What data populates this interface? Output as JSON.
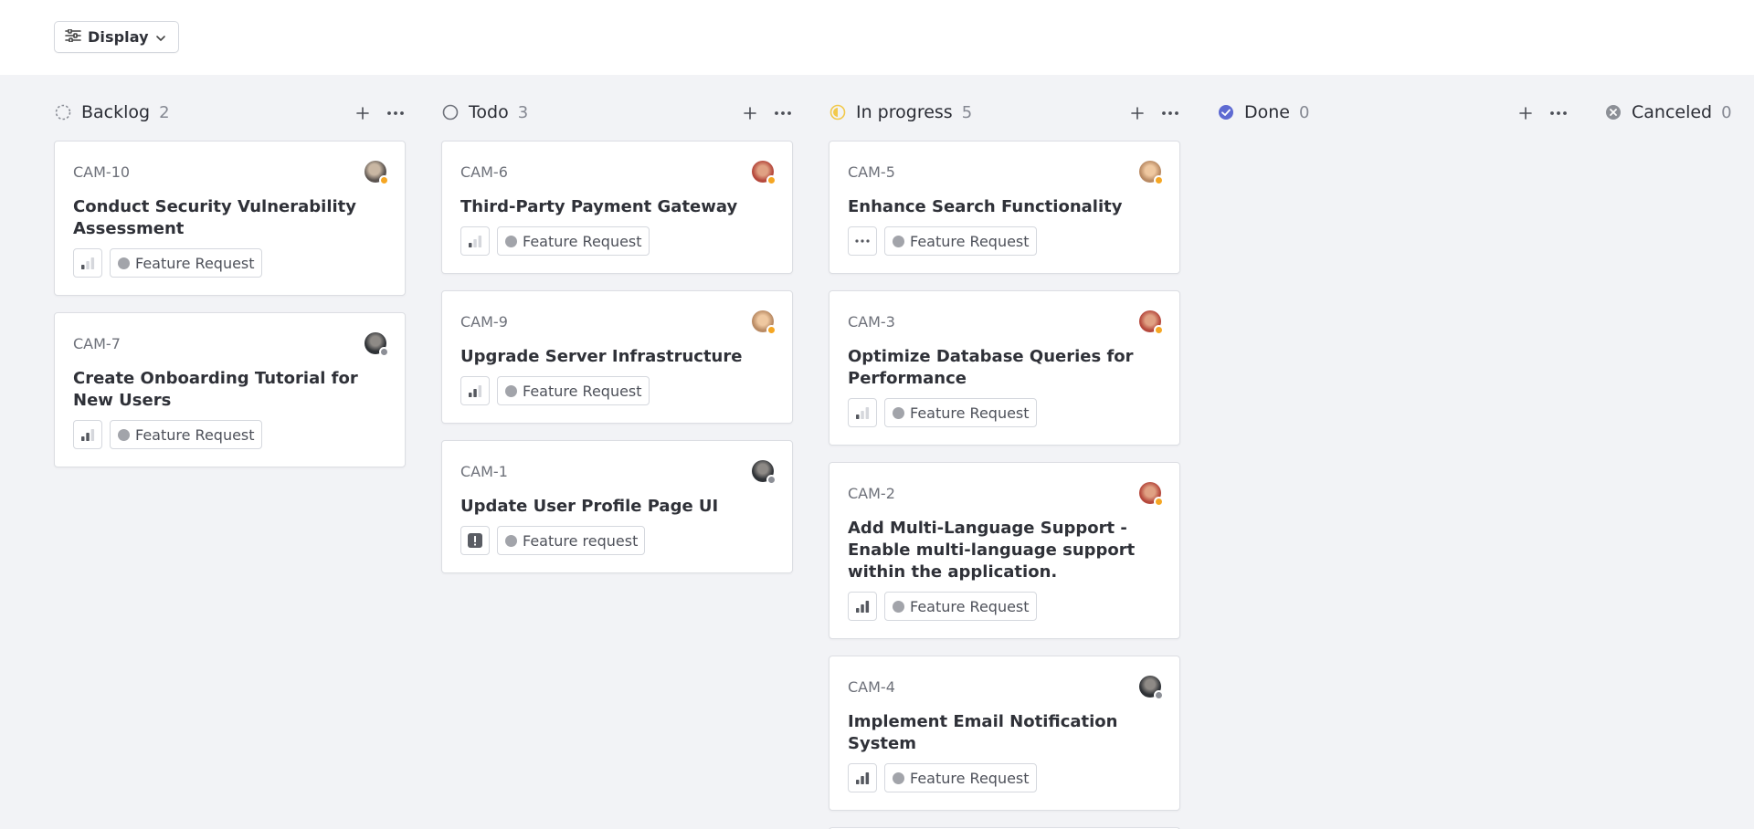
{
  "toolbar": {
    "display_label": "Display"
  },
  "columns": [
    {
      "title": "Backlog",
      "count": "2",
      "cards": [
        {
          "id": "CAM-10",
          "title": "Conduct Security Vulnerability Assessment",
          "label": "Feature Request",
          "priority": "low",
          "avatar_status": "away"
        },
        {
          "id": "CAM-7",
          "title": "Create Onboarding Tutorial for New Users",
          "label": "Feature Request",
          "priority": "medium",
          "avatar_status": "offline"
        }
      ]
    },
    {
      "title": "Todo",
      "count": "3",
      "cards": [
        {
          "id": "CAM-6",
          "title": "Third-Party Payment Gateway",
          "label": "Feature Request",
          "priority": "low",
          "avatar_status": "away"
        },
        {
          "id": "CAM-9",
          "title": "Upgrade Server Infrastructure",
          "label": "Feature Request",
          "priority": "medium",
          "avatar_status": "away"
        },
        {
          "id": "CAM-1",
          "title": "Update User Profile Page UI",
          "label": "Feature request",
          "priority": "urgent",
          "avatar_status": "offline"
        }
      ]
    },
    {
      "title": "In progress",
      "count": "5",
      "cards": [
        {
          "id": "CAM-5",
          "title": "Enhance Search Functionality",
          "label": "Feature Request",
          "priority": "none",
          "avatar_status": "away"
        },
        {
          "id": "CAM-3",
          "title": "Optimize Database Queries for Performance",
          "label": "Feature Request",
          "priority": "low",
          "avatar_status": "away"
        },
        {
          "id": "CAM-2",
          "title": "Add Multi-Language Support - Enable multi-language support within the application.",
          "label": "Feature Request",
          "priority": "high",
          "avatar_status": "away"
        },
        {
          "id": "CAM-4",
          "title": "Implement Email Notification System",
          "label": "Feature Request",
          "priority": "high",
          "avatar_status": "offline"
        }
      ]
    },
    {
      "title": "Done",
      "count": "0",
      "cards": []
    },
    {
      "title": "Canceled",
      "count": "0",
      "cards": []
    }
  ],
  "colors": {
    "page_bg": "#f2f3f6",
    "in_progress": "#f2c94c",
    "done": "#5e6ad2",
    "status_away": "#f5a623",
    "status_offline": "#8c8f96",
    "label_dot": "#a2a4aa"
  },
  "icons": {
    "display": "sliders-icon",
    "backlog": "dashed-circle-icon",
    "todo": "circle-icon",
    "in_progress": "half-circle-icon",
    "done": "check-circle-icon",
    "canceled": "x-circle-icon"
  }
}
